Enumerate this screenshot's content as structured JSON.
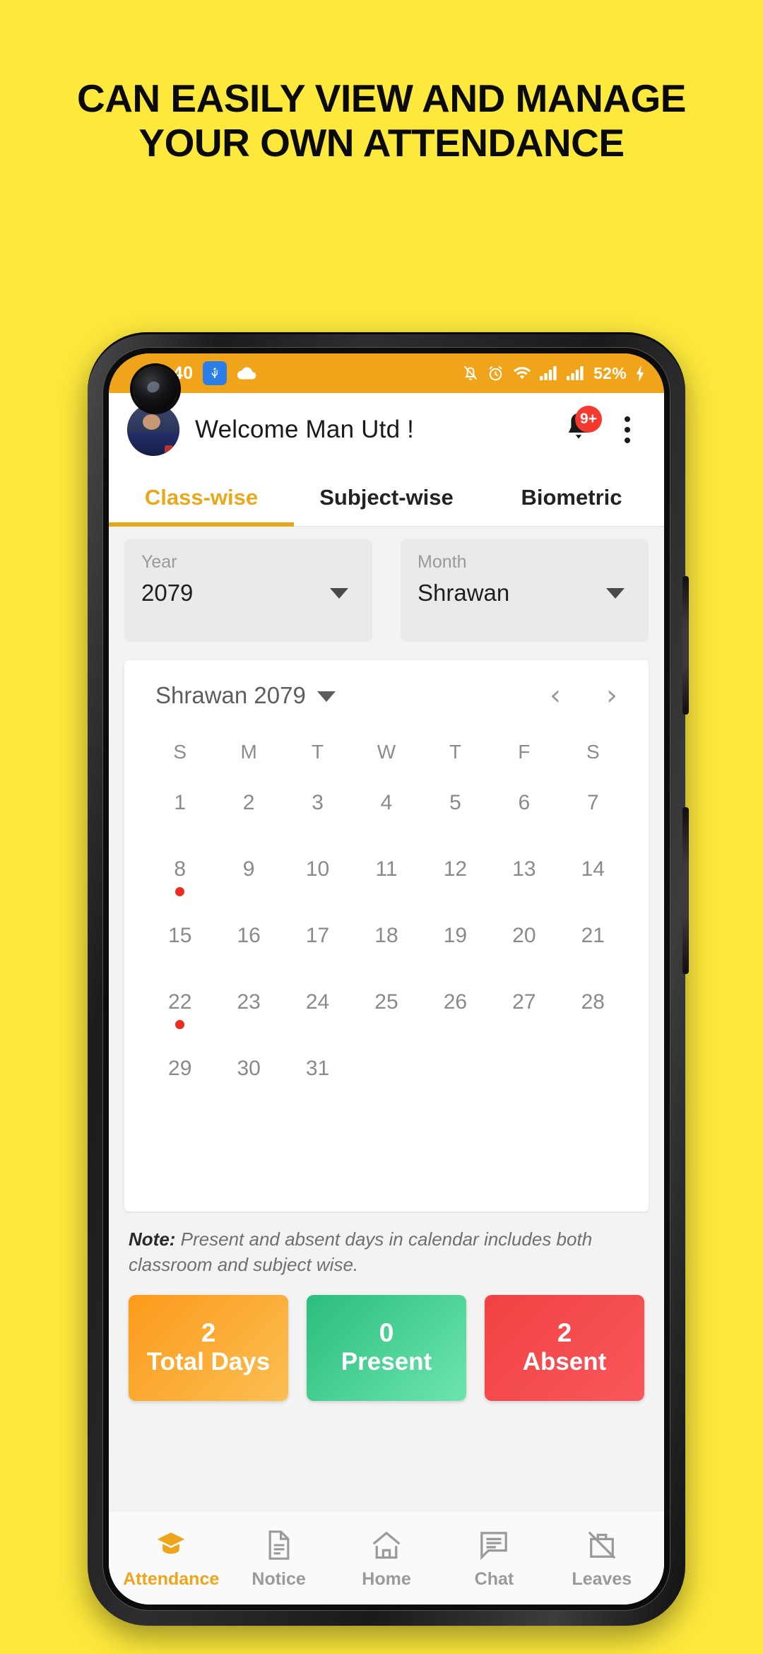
{
  "promo": {
    "heading": "CAN EASILY VIEW AND MANAGE YOUR OWN ATTENDANCE",
    "background_color": "#FDE93C"
  },
  "status_bar": {
    "time": ":40",
    "usb_icon": "usb-icon",
    "cloud_icon": "cloud-icon",
    "silent_icon": "bell-slash-icon",
    "alarm_icon": "alarm-clock-icon",
    "wifi_icon": "wifi-icon",
    "signal_one_icon": "signal-bars-icon",
    "signal_two_icon": "signal-bars-icon",
    "battery_percent": "52%",
    "charging_icon": "charging-bolt-icon",
    "background_color": "#F0A41A"
  },
  "app_bar": {
    "avatar_name": "user-avatar",
    "title": "Welcome Man Utd !",
    "notification_badge": "9+",
    "bell_icon": "bell-icon",
    "overflow_icon": "more-vertical-icon",
    "badge_color": "#F4392F"
  },
  "tabs": {
    "active_index": 0,
    "accent_color": "#E8A81C",
    "items": [
      {
        "label": "Class-wise"
      },
      {
        "label": "Subject-wise"
      },
      {
        "label": "Biometric"
      }
    ]
  },
  "filters": {
    "year": {
      "label": "Year",
      "value": "2079"
    },
    "month": {
      "label": "Month",
      "value": "Shrawan"
    }
  },
  "calendar": {
    "title": "Shrawan 2079",
    "prev_icon": "chevron-left-icon",
    "next_icon": "chevron-right-icon",
    "dropdown_icon": "caret-down-icon",
    "weekdays": [
      "S",
      "M",
      "T",
      "W",
      "T",
      "F",
      "S"
    ],
    "leading_blanks": 0,
    "days": [
      {
        "n": "1"
      },
      {
        "n": "2"
      },
      {
        "n": "3"
      },
      {
        "n": "4"
      },
      {
        "n": "5"
      },
      {
        "n": "6"
      },
      {
        "n": "7"
      },
      {
        "n": "8",
        "marker": "absent"
      },
      {
        "n": "9"
      },
      {
        "n": "10"
      },
      {
        "n": "11"
      },
      {
        "n": "12"
      },
      {
        "n": "13"
      },
      {
        "n": "14"
      },
      {
        "n": "15"
      },
      {
        "n": "16"
      },
      {
        "n": "17"
      },
      {
        "n": "18"
      },
      {
        "n": "19"
      },
      {
        "n": "20"
      },
      {
        "n": "21"
      },
      {
        "n": "22",
        "marker": "absent"
      },
      {
        "n": "23"
      },
      {
        "n": "24"
      },
      {
        "n": "25"
      },
      {
        "n": "26"
      },
      {
        "n": "27"
      },
      {
        "n": "28"
      },
      {
        "n": "29"
      },
      {
        "n": "30"
      },
      {
        "n": "31"
      }
    ],
    "marker_color": "#EE2B22"
  },
  "note": {
    "prefix": "Note:",
    "text": " Present and absent days in calendar includes both classroom and subject wise."
  },
  "stats": [
    {
      "value": "2",
      "label": "Total Days",
      "color": "#FB9A1B"
    },
    {
      "value": "0",
      "label": "Present",
      "color": "#2BBD7E"
    },
    {
      "value": "2",
      "label": "Absent",
      "color": "#F04141"
    }
  ],
  "bottom_nav": {
    "active_index": 0,
    "active_color": "#EFA51B",
    "items": [
      {
        "label": "Attendance",
        "icon": "graduation-cap-icon"
      },
      {
        "label": "Notice",
        "icon": "document-icon"
      },
      {
        "label": "Home",
        "icon": "home-icon"
      },
      {
        "label": "Chat",
        "icon": "chat-bubble-icon"
      },
      {
        "label": "Leaves",
        "icon": "bag-slash-icon"
      }
    ]
  },
  "soft_keys": {
    "recents_icon": "recents-icon",
    "home_icon": "home-square-icon",
    "back_icon": "back-triangle-icon"
  }
}
